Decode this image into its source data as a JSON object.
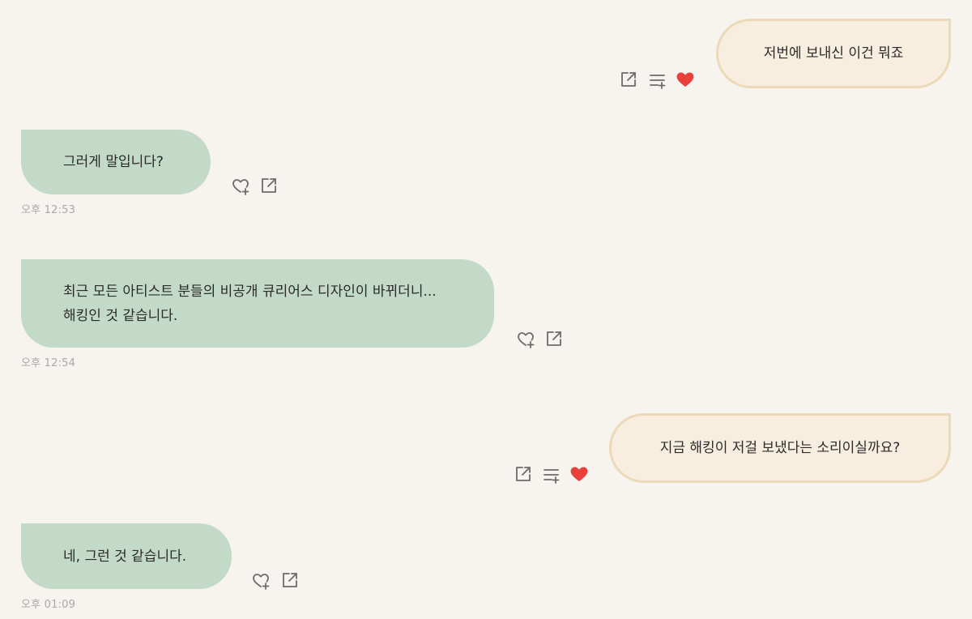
{
  "messages": [
    {
      "direction": "outgoing",
      "text": "저번에 보내신 이건 뭐죠",
      "liked": true,
      "actions": [
        "share-icon",
        "add-to-playlist-icon",
        "heart-filled-icon"
      ]
    },
    {
      "direction": "incoming",
      "text": "그러게 말입니다?",
      "time": "오후 12:53",
      "actions": [
        "heart-add-icon",
        "share-icon"
      ]
    },
    {
      "direction": "incoming",
      "text": "최근 모든 아티스트 분들의 비공개 큐리어스 디자인이 바뀌더니...\n해킹인 것 같습니다.",
      "time": "오후 12:54",
      "actions": [
        "heart-add-icon",
        "share-icon"
      ]
    },
    {
      "direction": "outgoing",
      "text": "지금 해킹이 저걸 보냈다는 소리이실까요?",
      "liked": true,
      "actions": [
        "share-icon",
        "add-to-playlist-icon",
        "heart-filled-icon"
      ]
    },
    {
      "direction": "incoming",
      "text": "네, 그런 것 같습니다.",
      "time": "오후 01:09",
      "actions": [
        "heart-add-icon",
        "share-icon"
      ]
    }
  ],
  "colors": {
    "background": "#f7f3ee",
    "incoming_bubble": "#c3dac9",
    "outgoing_bubble": "#f8eee0",
    "outgoing_border": "#ecd9b8",
    "liked_heart": "#e8403a",
    "icon_gray": "#6b6b6b",
    "timestamp": "#a9a9a9"
  }
}
